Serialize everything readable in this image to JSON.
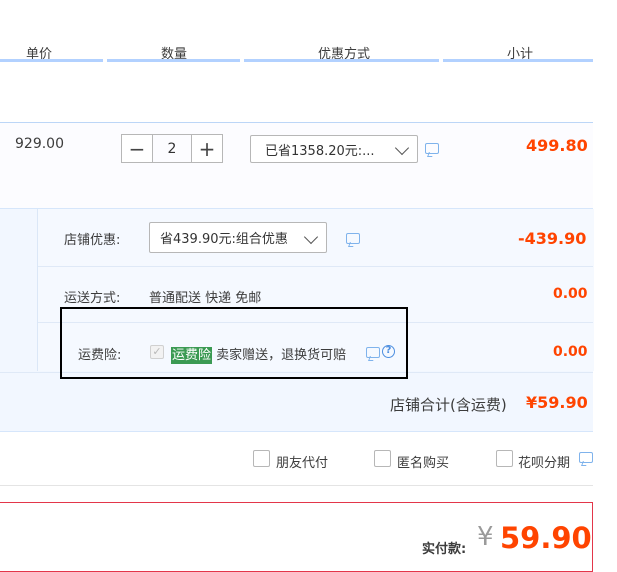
{
  "header": {
    "unit_price": "单价",
    "quantity": "数量",
    "discount": "优惠方式",
    "subtotal": "小计"
  },
  "item": {
    "unit_price": "929.00",
    "quantity": "2",
    "minus": "−",
    "plus": "+",
    "discount_selected": "已省1358.20元:...",
    "subtotal": "499.80"
  },
  "shop": {
    "promo_label": "店铺优惠:",
    "promo_selected": "省439.90元:组合优惠",
    "promo_amount": "-439.90",
    "shipping_label": "运送方式:",
    "shipping_value": "普通配送 快递 免邮",
    "shipping_amount": "0.00",
    "insurance_label": "运费险:",
    "insurance_tag": "运费险",
    "insurance_desc": "卖家赠送，退换货可赔",
    "insurance_amount": "0.00",
    "total_label": "店铺合计(含运费)",
    "total_amount": "¥59.90"
  },
  "options": {
    "friend_pay": "朋友代付",
    "anonymous": "匿名购买",
    "huabei": "花呗分期"
  },
  "payment": {
    "label": "实付款:",
    "currency": "¥",
    "amount": "59.90"
  },
  "colors": {
    "accent_orange": "#ff4400",
    "header_line": "#b2d1ff",
    "highlight_box": "#000000",
    "insurance_tag_bg": "#3b9a53"
  }
}
